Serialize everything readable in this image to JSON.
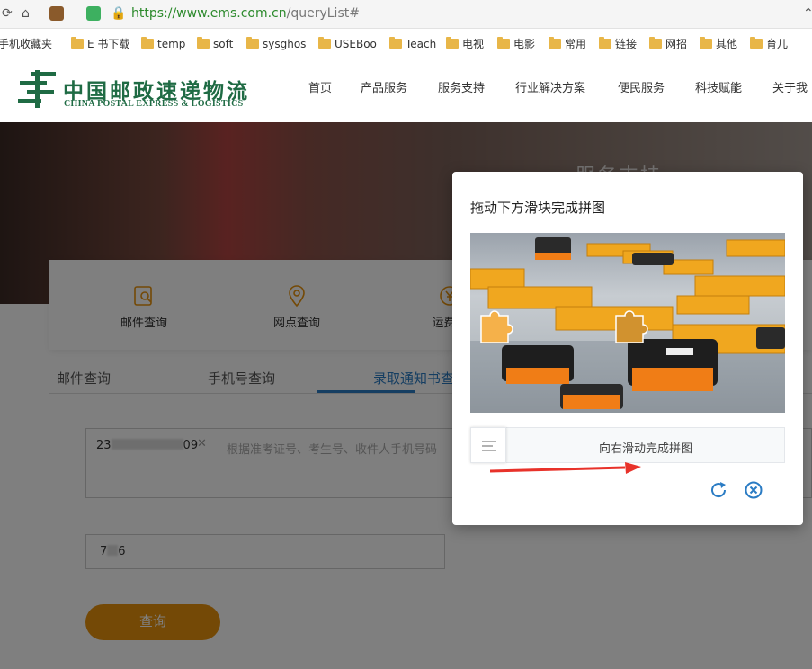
{
  "browser": {
    "url_host": "https://www.ems.com.cn",
    "url_path": "/queryList#",
    "bookmarks": [
      "手机收藏夹",
      "E 书下载",
      "temp",
      "soft",
      "sysghos",
      "USEBoo",
      "Teach",
      "电视",
      "电影",
      "常用",
      "链接",
      "网招",
      "其他",
      "育儿"
    ]
  },
  "site": {
    "logo_cn": "中国邮政速递物流",
    "logo_en": "CHINA POSTAL EXPRESS & LOGISTICS",
    "menu": [
      "首页",
      "产品服务",
      "服务支持",
      "行业解决方案",
      "便民服务",
      "科技赋能",
      "关于我"
    ],
    "banner_text": "服务支持"
  },
  "services": [
    {
      "label": "邮件查询",
      "icon": "mail-search-icon"
    },
    {
      "label": "网点查询",
      "icon": "location-pin-icon"
    },
    {
      "label": "运费时",
      "icon": "yen-coin-icon"
    }
  ],
  "tabs": [
    "邮件查询",
    "手机号查询",
    "录取通知书查"
  ],
  "form": {
    "textarea_prefix": "23",
    "textarea_suffix": "09",
    "clear_symbol": "✕",
    "textarea_placeholder": "根据准考证号、考生号、收件人手机号码",
    "code_prefix": "7",
    "code_suffix": "6",
    "query_label": "查询"
  },
  "captcha": {
    "title": "拖动下方滑块完成拼图",
    "slider_text": "向右滑动完成拼图",
    "refresh_icon": "refresh-icon",
    "close_icon": "close-circle-icon",
    "colors": {
      "accent": "#2b7cc4",
      "arrow": "#e8322a"
    }
  }
}
